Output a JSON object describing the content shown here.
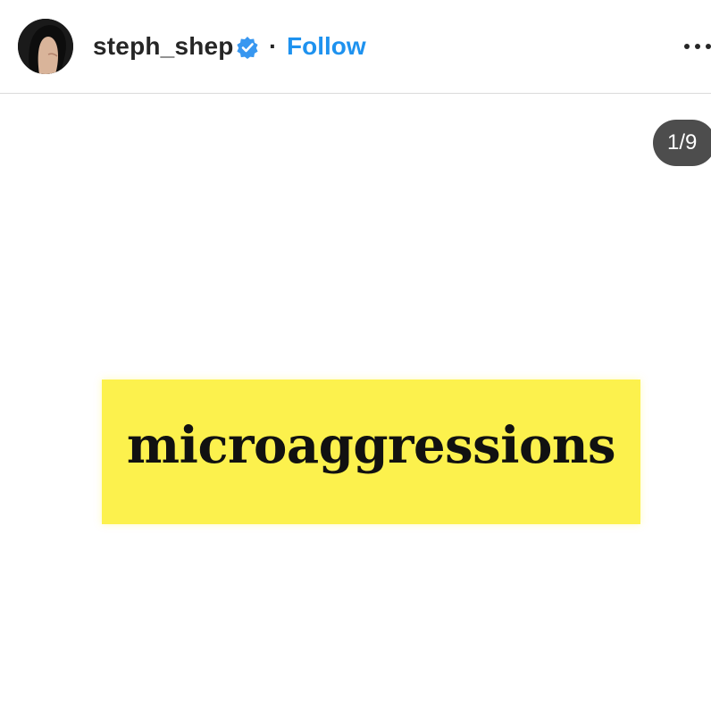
{
  "post": {
    "username": "steph_shep",
    "separator": "·",
    "follow_label": "Follow",
    "verified_icon": "verified-badge-icon",
    "more_icon": "more-options-icon",
    "accent_color": "#1e92ef"
  },
  "media": {
    "slide_counter": "1/9",
    "image_text": "microaggressions",
    "banner_color": "#fcf14d"
  }
}
